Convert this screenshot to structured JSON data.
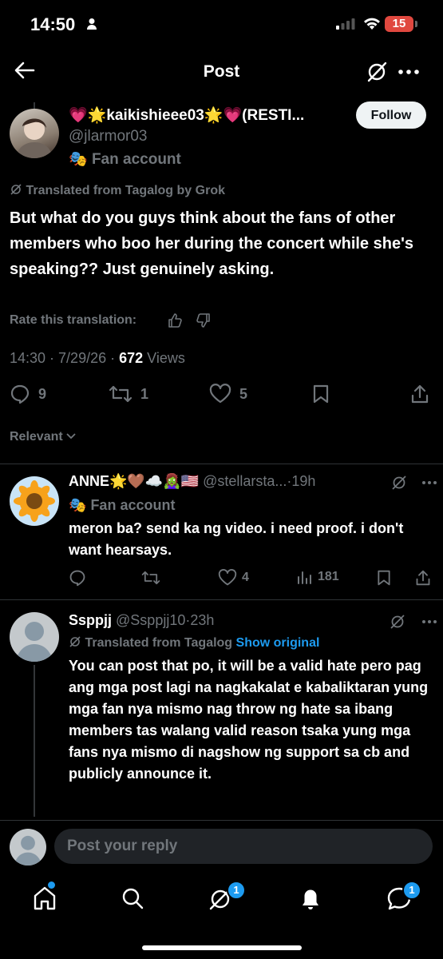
{
  "status_bar": {
    "time": "14:50",
    "battery": "15"
  },
  "header": {
    "title": "Post"
  },
  "post": {
    "author_name": "💗🌟kaikishieee03🌟💗(RESTI...",
    "author_handle": "@jlarmor03",
    "fan_badge": "Fan account",
    "follow_label": "Follow",
    "translated_label": "Translated from Tagalog by Grok",
    "text": "But what do you guys think about the fans of other members who boo her during the concert while she's speaking?? Just genuinely asking.",
    "rate_label": "Rate this translation:",
    "time_date": "14:30 · 7/29/26 · ",
    "views_count": "672",
    "views_label": " Views",
    "replies": "9",
    "reposts": "1",
    "likes": "5"
  },
  "sort": {
    "label": "Relevant"
  },
  "reply1": {
    "name": "ANNE🌟🤎☁️🧟‍♀️🇺🇸",
    "handle": "@stellarsta...",
    "time": "·19h",
    "fan_badge": "Fan account",
    "text": "meron ba? send ka ng video. i need proof. i don't want hearsays.",
    "likes": "4",
    "views": "181"
  },
  "reply2": {
    "name": "Ssppjj",
    "handle": "@Ssppjj10",
    "time": "·23h",
    "translated_label": "Translated from Tagalog",
    "show_original": "Show original",
    "text": "You can post that po, it will be a valid hate pero pag ang mga post lagi na nagkakalat e kabaliktaran yung mga fan nya mismo nag throw ng hate sa ibang members tas walang valid reason tsaka yung mga fans nya mismo di nagshow ng support sa cb and publicly announce it."
  },
  "composer": {
    "placeholder": "Post your reply"
  },
  "nav": {
    "grok_badge": "1",
    "messages_badge": "1"
  },
  "colors": {
    "accent": "#1d9bf0",
    "muted": "#71767b",
    "background": "#000000"
  }
}
